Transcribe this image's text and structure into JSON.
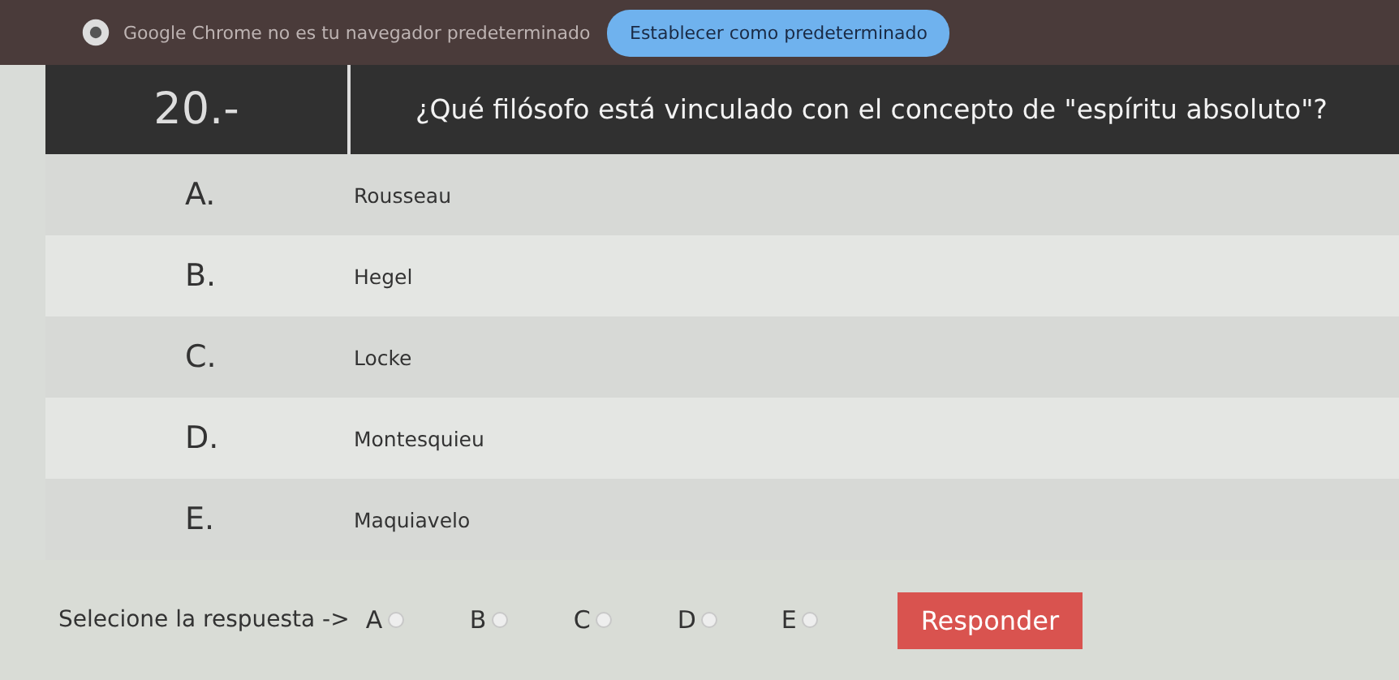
{
  "infobar": {
    "message": "Google Chrome no es tu navegador predeterminado",
    "button": "Establecer como predeterminado"
  },
  "question": {
    "number": "20.-",
    "text": "¿Qué filósofo está vinculado con el concepto de \"espíritu absoluto\"?"
  },
  "options": [
    {
      "letter": "A.",
      "text": "Rousseau"
    },
    {
      "letter": "B.",
      "text": "Hegel"
    },
    {
      "letter": "C.",
      "text": "Locke"
    },
    {
      "letter": "D.",
      "text": "Montesquieu"
    },
    {
      "letter": "E.",
      "text": "Maquiavelo"
    }
  ],
  "answer": {
    "prompt": "Selecione la respuesta ->",
    "choices": [
      {
        "label": "A",
        "selected": false
      },
      {
        "label": "B",
        "selected": false
      },
      {
        "label": "C",
        "selected": false
      },
      {
        "label": "D",
        "selected": false
      },
      {
        "label": "E",
        "selected": false
      }
    ],
    "button": "Responder"
  }
}
